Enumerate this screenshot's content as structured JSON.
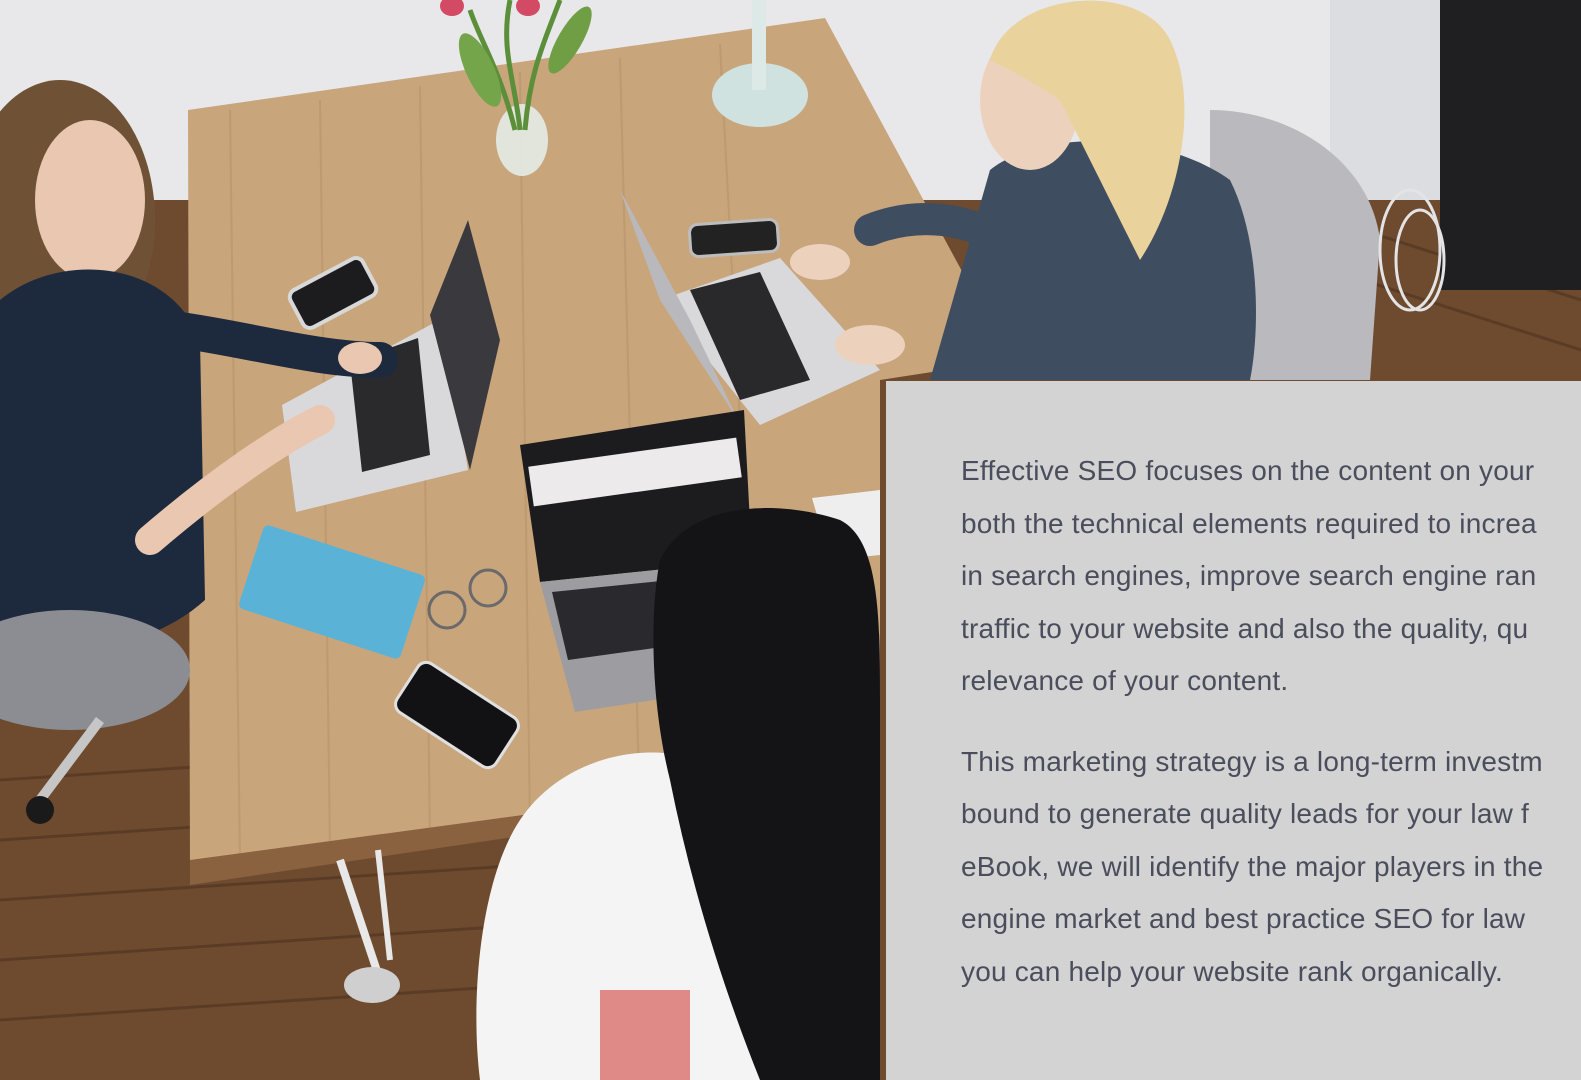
{
  "hero": {
    "image": "office-team-at-laptops-photo"
  },
  "content": {
    "paragraph_1": [
      "Effective SEO focuses on the content on your",
      "both the technical elements required to increa",
      "in search engines, improve search engine ran",
      "traffic to your website and also the quality, qu",
      "relevance of your content."
    ],
    "paragraph_2": [
      "This marketing strategy is a long-term investm",
      "bound to generate quality leads for your law f",
      "eBook, we will identify the major players in the",
      "engine market and best practice SEO for law",
      "you can help your website rank organically."
    ]
  },
  "colors": {
    "card_background": "#d3d3d4",
    "body_text": "#4a4d5b",
    "table_wood": "#c9a57c",
    "floor_wood": "#6b4a2e",
    "wall": "#e9e9eb"
  }
}
